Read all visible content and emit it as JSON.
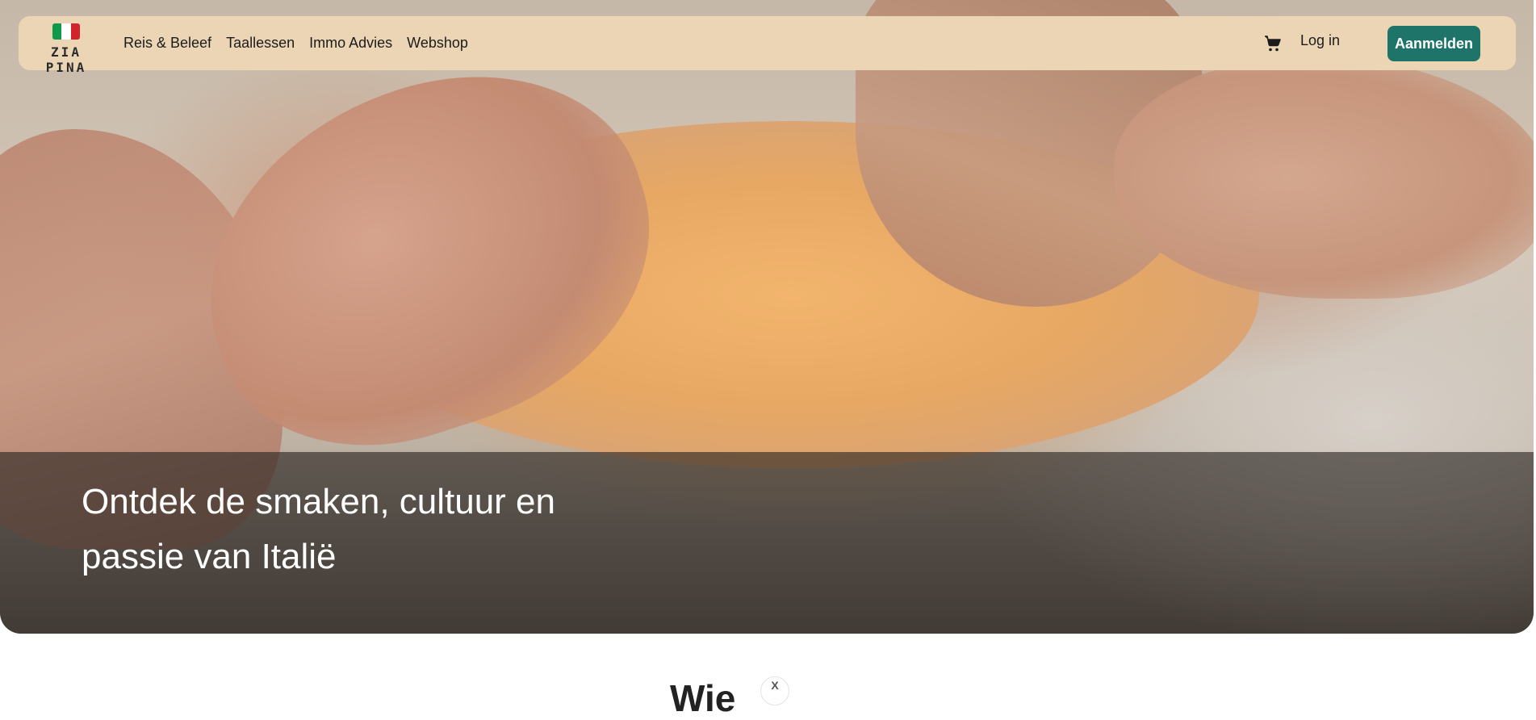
{
  "brand": {
    "name": "ZIA PINA",
    "flag_colors": [
      "#0e9a48",
      "#ffffff",
      "#d2232a"
    ]
  },
  "nav": {
    "links": [
      "Reis & Beleef",
      "Taallessen",
      "Immo Advies",
      "Webshop"
    ],
    "cart_icon": "cart-icon",
    "login_label": "Log in",
    "signup_label": "Aanmelden"
  },
  "hero": {
    "headline": "Ontdek de smaken, cultuur en passie van Italië"
  },
  "next_section": {
    "heading_partial": "Wie",
    "badge": "X"
  },
  "colors": {
    "navbar_bg": "#ebd5b5",
    "accent": "#1e7468",
    "overlay": "rgba(40,36,32,0.62)"
  }
}
